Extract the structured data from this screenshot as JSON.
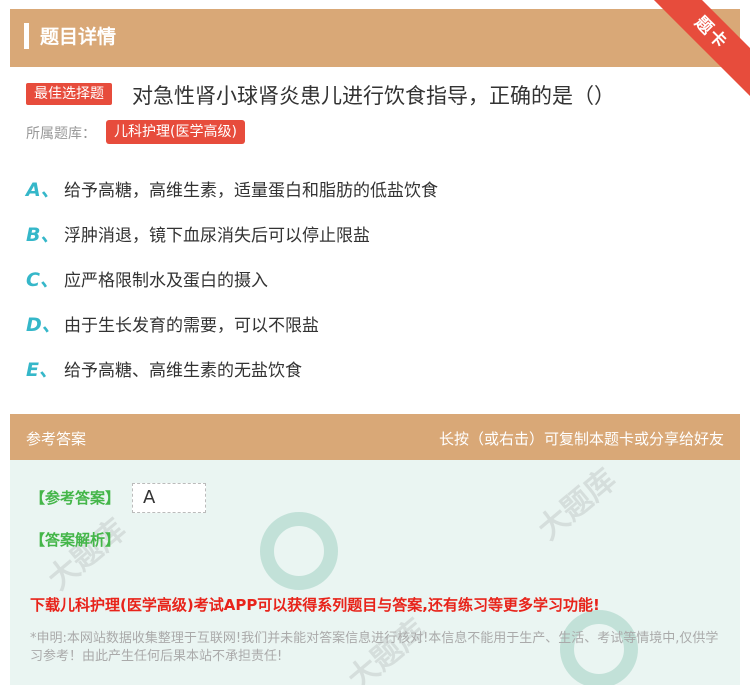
{
  "header": {
    "title": "题目详情",
    "ribbon": "题卡"
  },
  "question": {
    "type_badge": "最佳选择题",
    "text": "对急性肾小球肾炎患儿进行饮食指导，正确的是（）",
    "bank_label": "所属题库：",
    "bank_name": "儿科护理(医学高级)"
  },
  "options": [
    {
      "letter": "A、",
      "text": "给予高糖，高维生素，适量蛋白和脂肪的低盐饮食"
    },
    {
      "letter": "B、",
      "text": "浮肿消退，镜下血尿消失后可以停止限盐"
    },
    {
      "letter": "C、",
      "text": "应严格限制水及蛋白的摄入"
    },
    {
      "letter": "D、",
      "text": "由于生长发育的需要，可以不限盐"
    },
    {
      "letter": "E、",
      "text": "给予高糖、高维生素的无盐饮食"
    }
  ],
  "answer_section": {
    "title": "参考答案",
    "hint": "长按（或右击）可复制本题卡或分享给好友",
    "ref_label": "【参考答案】",
    "ref_value": "A",
    "analysis_label": "【答案解析】",
    "download_text": "下载儿科护理(医学高级)考试APP可以获得系列题目与答案,还有练习等更多学习功能!",
    "disclaimer": "*申明:本网站数据收集整理于互联网!我们并未能对答案信息进行核对!本信息不能用于生产、生活、考试等情境中,仅供学习参考！由此产生任何后果本站不承担责任!"
  },
  "colors": {
    "accent": "#d9a877",
    "badge": "#e74c3c",
    "option_letter": "#35b7c9",
    "green": "#44b649",
    "red_text": "#e8231a"
  }
}
